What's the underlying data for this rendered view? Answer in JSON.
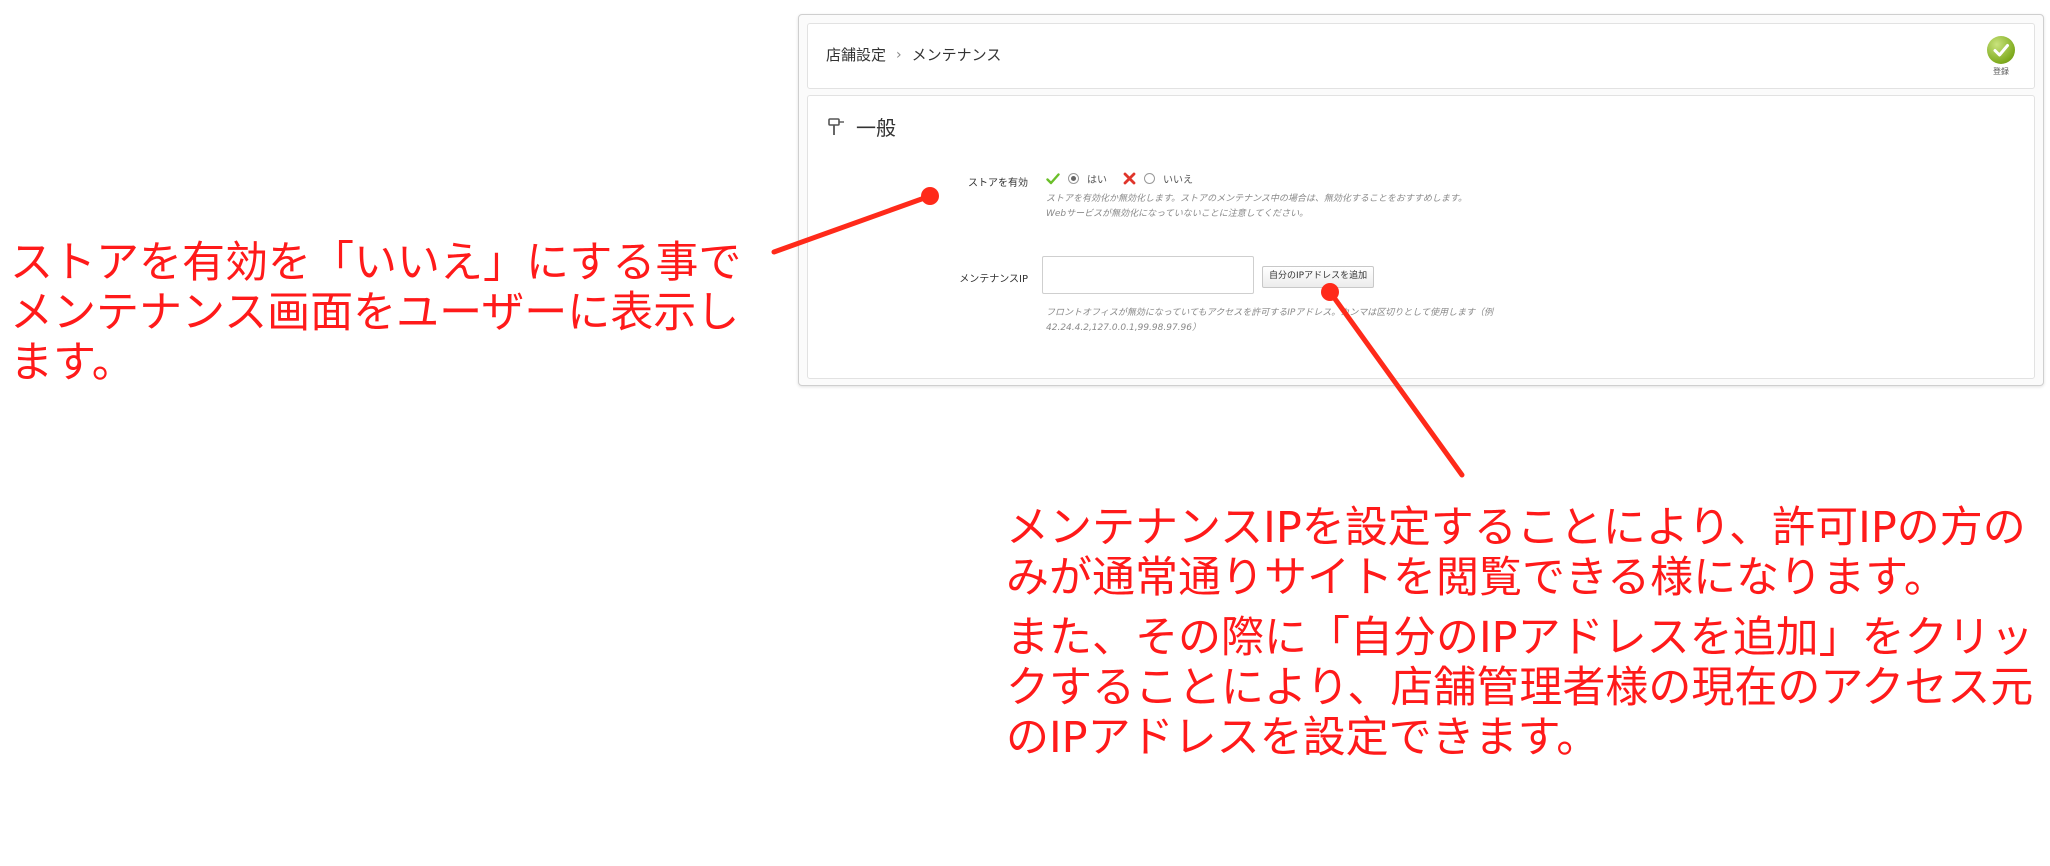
{
  "breadcrumb": {
    "parent": "店舗設定",
    "separator": "›",
    "current": "メンテナンス"
  },
  "toolbar": {
    "save_label": "登録"
  },
  "section": {
    "title": "一般"
  },
  "store_enabled": {
    "label": "ストアを有効",
    "option_yes": "はい",
    "option_no": "いいえ",
    "selected": "はい",
    "help": "ストアを有効化か無効化します。ストアのメンテナンス中の場合は、無効化することをおすすめします。Webサービスが無効化になっていないことに注意してください。"
  },
  "maintenance_ip": {
    "label": "メンテナンスIP",
    "value": "",
    "add_button": "自分のIPアドレスを追加",
    "help": "フロントオフィスが無効になっていてもアクセスを許可するIPアドレス。カンマは区切りとして使用します（例　42.24.4.2,127.0.0.1,99.98.97.96）"
  },
  "annotations": {
    "left": "ストアを有効を「いいえ」にする事でメンテナンス画面をユーザーに表示します。",
    "right_1": "メンテナンスIPを設定することにより、許可IPの方のみが通常通りサイトを閲覧できる様になります。",
    "right_2": "また、その際に「自分のIPアドレスを追加」をクリックすることにより、店舗管理者様の現在のアクセス元のIPアドレスを設定できます。"
  },
  "colors": {
    "annotation": "#ff1a1a",
    "check_green": "#6bbf2a",
    "cross_red": "#e0352b"
  }
}
